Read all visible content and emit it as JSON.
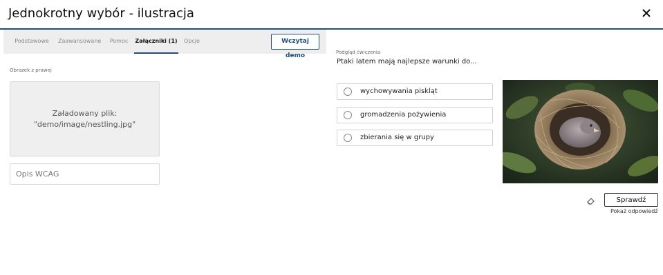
{
  "dialog": {
    "title": "Jednokrotny wybór - ilustracja",
    "close_icon": "close-icon"
  },
  "tabs": [
    {
      "label": "Podstawowe",
      "active": false
    },
    {
      "label": "Zaawansowane",
      "active": false
    },
    {
      "label": "Pomoc",
      "active": false
    },
    {
      "label": "Załączniki (1)",
      "active": true
    },
    {
      "label": "Opcje",
      "active": false
    }
  ],
  "demo_button": "Wczytaj demo",
  "attachment": {
    "label": "Obrazek z prawej",
    "uploaded_line1": "Załadowany plik:",
    "uploaded_line2": "\"demo/image/nestling.jpg\"",
    "wcag_placeholder": "Opis WCAG",
    "wcag_value": ""
  },
  "preview": {
    "label": "Podgląd ćwiczenia",
    "question": "Ptaki latem mają najlepsze warunki do...",
    "options": [
      {
        "label": "wychowywania piskląt",
        "selected": false
      },
      {
        "label": "gromadzenia pożywienia",
        "selected": false
      },
      {
        "label": "zbierania się w grupy",
        "selected": false
      }
    ],
    "check_button": "Sprawdź",
    "show_answer": "Pokaż odpowiedź",
    "eraser_icon": "eraser-icon"
  },
  "colors": {
    "accent": "#1f4e79",
    "tab_bg": "#eeeeee",
    "upload_bg": "#efefef"
  }
}
